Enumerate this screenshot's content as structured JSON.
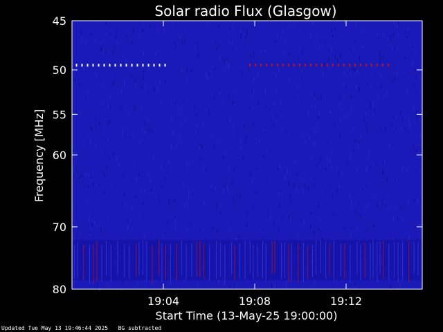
{
  "chart_data": {
    "type": "heatmap",
    "title": "Solar radio Flux (Glasgow)",
    "xlabel": "Start Time (13-May-25 19:00:00)",
    "ylabel": "Frequency [MHz]",
    "x_start": "19:00:00",
    "x_end": "19:15:20",
    "x_ticks": [
      "19:04",
      "19:08",
      "19:12"
    ],
    "y_ticks": [
      45,
      50,
      55,
      60,
      70,
      80
    ],
    "y_scale": "log",
    "ylim": [
      45,
      80
    ],
    "colors": {
      "background": "#1a1ab8",
      "signal": "#cc1010",
      "hot": "#ffffff"
    },
    "features": [
      {
        "kind": "persistent-emission",
        "freq_mhz": 49.5,
        "t_start": "19:00:10",
        "t_end": "19:04:15"
      },
      {
        "kind": "persistent-emission",
        "freq_mhz": 49.5,
        "t_start": "19:07:45",
        "t_end": "19:14:00"
      },
      {
        "kind": "interference-band",
        "freq_range_mhz": [
          72.0,
          78.5
        ]
      }
    ]
  },
  "footer": {
    "updated": "Updated Tue May 13 19:46:44 2025",
    "note": "BG subtracted"
  }
}
